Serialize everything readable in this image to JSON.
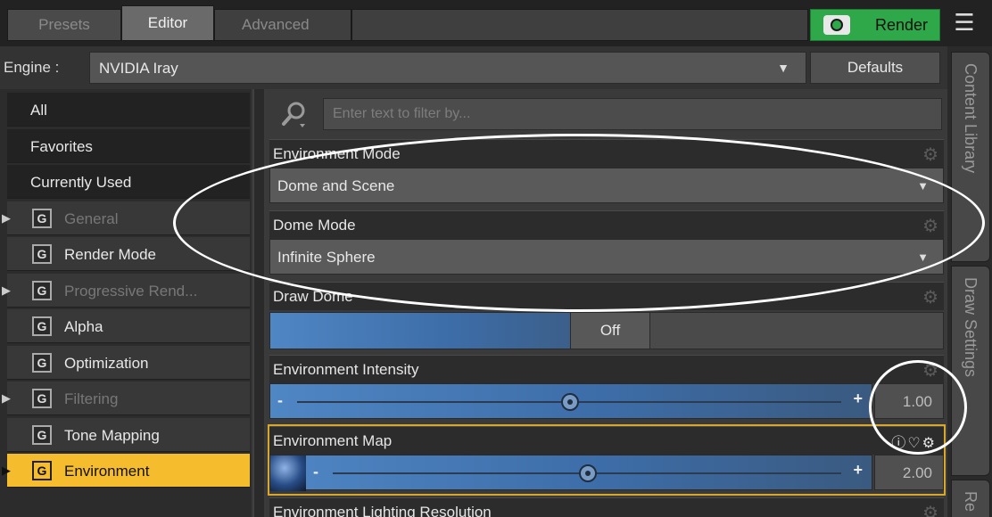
{
  "tabs": {
    "presets": "Presets",
    "editor": "Editor",
    "advanced": "Advanced"
  },
  "render": {
    "label": "Render",
    "camera_icon": "camera-icon"
  },
  "engine": {
    "label": "Engine :",
    "value": "NVIDIA Iray",
    "defaults": "Defaults"
  },
  "categories": [
    {
      "label": "All",
      "type": "plain"
    },
    {
      "label": "Favorites",
      "type": "plain"
    },
    {
      "label": "Currently Used",
      "type": "plain"
    },
    {
      "label": "General",
      "type": "group",
      "expandable": true,
      "dim": true
    },
    {
      "label": "Render Mode",
      "type": "group",
      "expandable": false
    },
    {
      "label": "Progressive Rend...",
      "type": "group",
      "expandable": true,
      "dim": true
    },
    {
      "label": "Alpha",
      "type": "group",
      "expandable": false
    },
    {
      "label": "Optimization",
      "type": "group",
      "expandable": false
    },
    {
      "label": "Filtering",
      "type": "group",
      "expandable": true,
      "dim": true
    },
    {
      "label": "Tone Mapping",
      "type": "group",
      "expandable": false
    },
    {
      "label": "Environment",
      "type": "group",
      "expandable": true,
      "selected": true
    }
  ],
  "group_icon_letter": "G",
  "filter": {
    "placeholder": "Enter text to filter by..."
  },
  "props": {
    "env_mode": {
      "label": "Environment Mode",
      "value": "Dome and Scene"
    },
    "dome_mode": {
      "label": "Dome Mode",
      "value": "Infinite Sphere"
    },
    "draw_dome": {
      "label": "Draw Dome",
      "value": "Off"
    },
    "env_intensity": {
      "label": "Environment Intensity",
      "value": "1.00",
      "level": 0.5
    },
    "env_map": {
      "label": "Environment Map",
      "value": "2.00",
      "level": 0.5
    },
    "env_light_res": {
      "label": "Environment Lighting Resolution"
    }
  },
  "slider_signs": {
    "minus": "-",
    "plus": "+"
  },
  "side_tabs": [
    "Content Library",
    "Draw Settings",
    "Re"
  ],
  "colors": {
    "accent": "#f5bd2e",
    "render": "#2fa84a",
    "slider_fill": "#4f86c4"
  }
}
